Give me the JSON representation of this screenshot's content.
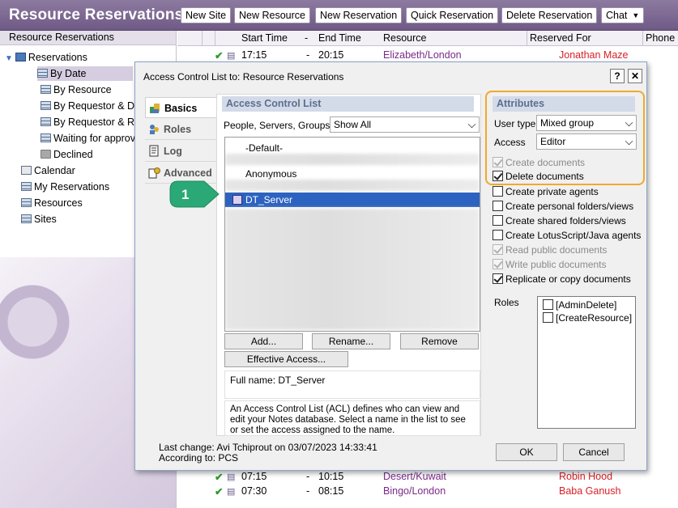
{
  "app": {
    "title": "Resource Reservations"
  },
  "toolbar": {
    "buttons": [
      "New Site",
      "New Resource",
      "New Reservation",
      "Quick Reservation",
      "Delete Reservation"
    ],
    "chat": "Chat"
  },
  "nav": {
    "header": "Resource Reservations",
    "items": [
      "Reservations",
      "By Date",
      "By Resource",
      "By Requestor & Da",
      "By Requestor & Re",
      "Waiting for approva",
      "Declined",
      "Calendar",
      "My Reservations",
      "Resources",
      "Sites"
    ]
  },
  "view": {
    "columns": [
      "Start Time",
      "-",
      "End Time",
      "Resource",
      "Reserved For",
      "Phone"
    ],
    "rows": [
      {
        "start": "17:15",
        "dash": "-",
        "end": "20:15",
        "resource": "Elizabeth/London",
        "reserved_for": "Jonathan Maze"
      },
      {
        "start": "07:15",
        "dash": "-",
        "end": "10:15",
        "resource": "Desert/Kuwait",
        "reserved_for": "Robin Hood"
      },
      {
        "start": "07:30",
        "dash": "-",
        "end": "08:15",
        "resource": "Bingo/London",
        "reserved_for": "Baba Ganush"
      }
    ]
  },
  "dialog": {
    "title": "Access Control List to: Resource Reservations",
    "help": "?",
    "close": "✕",
    "tabs": [
      "Basics",
      "Roles",
      "Log",
      "Advanced"
    ],
    "acl_header": "Access Control List",
    "filter_label": "People, Servers, Groups",
    "filter_value": "Show All",
    "entries": [
      "-Default-",
      "Anonymous",
      "DT_Server"
    ],
    "buttons": {
      "add": "Add...",
      "rename": "Rename...",
      "remove": "Remove",
      "effective": "Effective Access..."
    },
    "full_name": "Full name: DT_Server",
    "description": "An Access Control List (ACL) defines who can view and edit your Notes database.  Select a name in the list to see or set the access assigned to the name.",
    "attributes_header": "Attributes",
    "user_type_label": "User type",
    "user_type_value": "Mixed group",
    "access_label": "Access",
    "access_value": "Editor",
    "checkboxes": [
      {
        "label": "Create documents",
        "checked": true,
        "enabled": false
      },
      {
        "label": "Delete documents",
        "checked": true,
        "enabled": true
      },
      {
        "label": "Create private agents",
        "checked": false,
        "enabled": true
      },
      {
        "label": "Create personal folders/views",
        "checked": false,
        "enabled": true
      },
      {
        "label": "Create shared folders/views",
        "checked": false,
        "enabled": true
      },
      {
        "label": "Create LotusScript/Java agents",
        "checked": false,
        "enabled": true
      },
      {
        "label": "Read public documents",
        "checked": true,
        "enabled": false
      },
      {
        "label": "Write public documents",
        "checked": true,
        "enabled": false
      },
      {
        "label": "Replicate or copy documents",
        "checked": true,
        "enabled": true
      }
    ],
    "roles_label": "Roles",
    "roles": [
      "[AdminDelete]",
      "[CreateResource]"
    ],
    "last_change": "Last change: Avi Tchiprout on 03/07/2023 14:33:41",
    "according_to": "According to: PCS",
    "ok": "OK",
    "cancel": "Cancel"
  },
  "callout": {
    "number": "1",
    "color": "#2aa876"
  },
  "colors": {
    "accent": "#6f5a86",
    "highlight": "#f1a92a",
    "selection": "#2d63c0"
  }
}
